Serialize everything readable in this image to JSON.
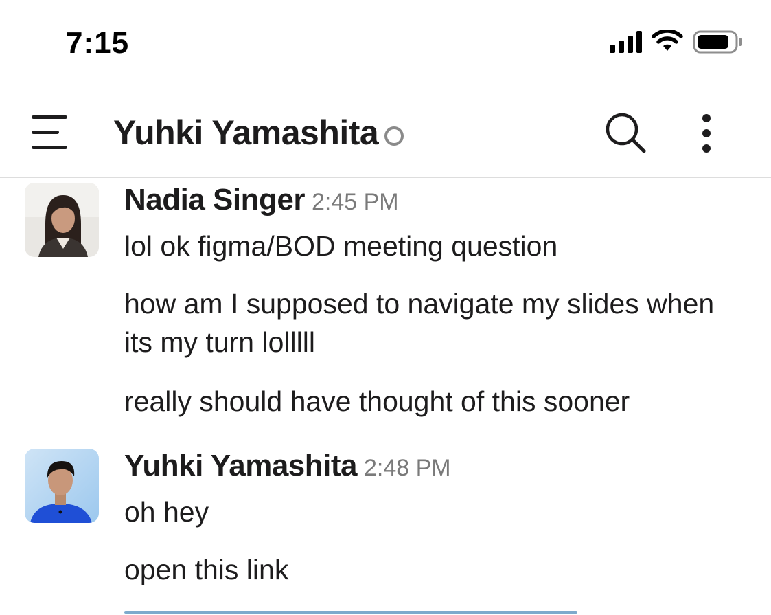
{
  "status_bar": {
    "time": "7:15"
  },
  "header": {
    "title": "Yuhki Yamashita",
    "presence": "away"
  },
  "messages": [
    {
      "sender": "Nadia Singer",
      "time": "2:45 PM",
      "lines": [
        "lol ok figma/BOD meeting question",
        "how am I supposed to navigate my slides when its my turn lolllll",
        "really should have thought of this sooner"
      ]
    },
    {
      "sender": "Yuhki Yamashita",
      "time": "2:48 PM",
      "lines": [
        "oh hey",
        "open this link"
      ]
    }
  ],
  "colors": {
    "text": "#1d1c1d",
    "timestamp": "#7a7a7a",
    "divider": "#dddddd",
    "link": "#1264a3"
  }
}
